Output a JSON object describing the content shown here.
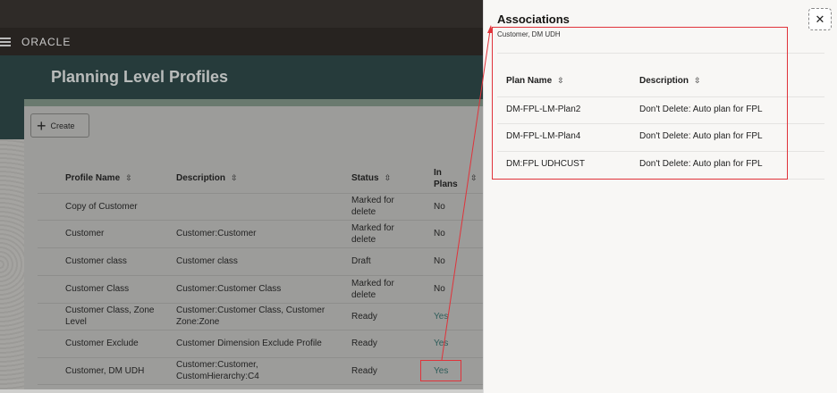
{
  "header": {
    "brand": "ORACLE",
    "page_title": "Planning Level Profiles"
  },
  "toolbar": {
    "create_label": "Create"
  },
  "table": {
    "columns": [
      "Profile Name",
      "Description",
      "Status",
      "In Plans"
    ],
    "in_plans_header": [
      "In",
      "Plans"
    ],
    "rows": [
      {
        "name": "Copy of Customer",
        "description": "",
        "status": "Marked for delete",
        "in_plans": "No"
      },
      {
        "name": "Customer",
        "description": "Customer:Customer",
        "status": "Marked for delete",
        "in_plans": "No"
      },
      {
        "name": "Customer class",
        "description": "Customer class",
        "status": "Draft",
        "in_plans": "No"
      },
      {
        "name": "Customer Class",
        "description": "Customer:Customer Class",
        "status": "Marked for delete",
        "in_plans": "No"
      },
      {
        "name": "Customer Class, Zone Level",
        "description": "Customer:Customer Class, Customer Zone:Zone",
        "status": "Ready",
        "in_plans": "Yes"
      },
      {
        "name": "Customer Exclude",
        "description": "Customer Dimension Exclude Profile",
        "status": "Ready",
        "in_plans": "Yes"
      },
      {
        "name": "Customer, DM UDH",
        "description": "Customer:Customer, CustomHierarchy:C4",
        "status": "Ready",
        "in_plans": "Yes"
      }
    ]
  },
  "panel": {
    "title": "Associations",
    "subtitle": "Customer, DM UDH",
    "close_label": "✕",
    "columns": [
      "Plan Name",
      "Description"
    ],
    "rows": [
      {
        "plan": "DM-FPL-LM-Plan2",
        "description": "Don't Delete: Auto plan for FPL"
      },
      {
        "plan": "DM-FPL-LM-Plan4",
        "description": "Don't Delete: Auto plan for FPL"
      },
      {
        "plan": "DM:FPL UDHCUST",
        "description": "Don't Delete: Auto plan for FPL"
      }
    ]
  },
  "colors": {
    "annotation": "#e0333a",
    "yes_link": "#2f5d5a"
  }
}
